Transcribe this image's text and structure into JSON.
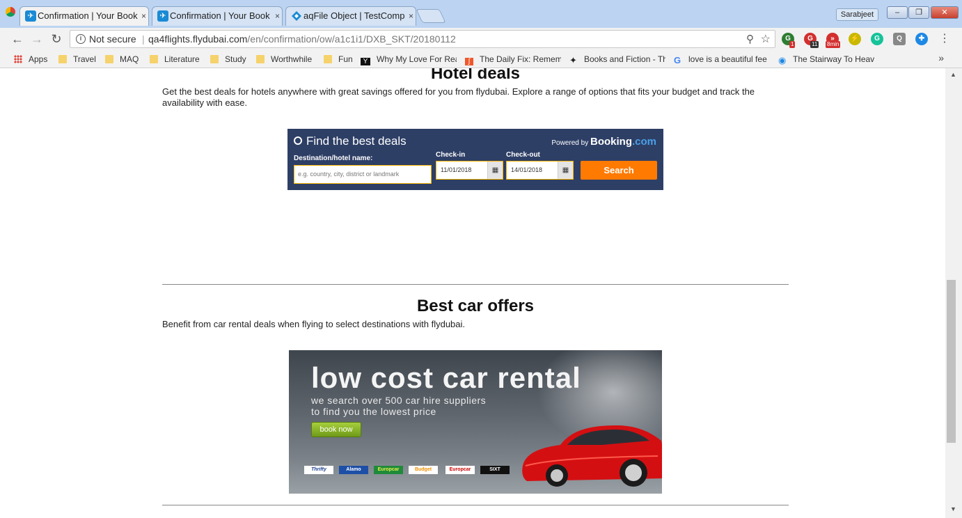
{
  "browser": {
    "tabs": [
      {
        "title": "Confirmation | Your Book",
        "state": "active"
      },
      {
        "title": "Confirmation | Your Book",
        "state": "inactive"
      },
      {
        "title": "aqFile Object | TestComp",
        "state": "inactive"
      }
    ],
    "close_glyph": "×",
    "user_name": "Sarabjeet",
    "window_buttons": {
      "minimize": "–",
      "restore": "❐",
      "close": "✕"
    },
    "nav": {
      "back": "←",
      "forward": "→",
      "reload": "↻"
    },
    "address_bar": {
      "security_label": "Not secure",
      "url_host": "qa4flights.flydubai.com",
      "url_path": "/en/confirmation/ow/a1c1i1/DXB_SKT/20180112"
    },
    "extensions": [
      {
        "name": "extension-1-icon",
        "glyph": "G",
        "color": "#2e7d32",
        "badge": "1"
      },
      {
        "name": "extension-2-icon",
        "glyph": "G",
        "color": "#d32f2f",
        "badge": "11"
      },
      {
        "name": "extension-3-icon",
        "glyph": "»",
        "color": "#d32f2f",
        "badge": "8min"
      },
      {
        "name": "extension-4-icon",
        "glyph": "⚡",
        "color": "#c9b800",
        "badge": ""
      },
      {
        "name": "grammarly-icon",
        "glyph": "G",
        "color": "#15c39a",
        "badge": ""
      },
      {
        "name": "extension-6-icon",
        "glyph": "Q",
        "color": "#888888",
        "badge": ""
      },
      {
        "name": "extension-7-icon",
        "glyph": "✚",
        "color": "#1e88e5",
        "badge": ""
      }
    ],
    "menu_glyph": "⋮",
    "bookmarks": [
      {
        "label": "Apps",
        "icon": "apps"
      },
      {
        "label": "Travel",
        "icon": "folder"
      },
      {
        "label": "MAQ",
        "icon": "folder"
      },
      {
        "label": "Literature",
        "icon": "folder"
      },
      {
        "label": "Study",
        "icon": "folder"
      },
      {
        "label": "Worthwhile",
        "icon": "folder"
      },
      {
        "label": "Fun",
        "icon": "folder"
      },
      {
        "label": "Why My Love For Rea",
        "icon": "y"
      },
      {
        "label": "The Daily Fix: Remem",
        "icon": "scroll"
      },
      {
        "label": "Books and Fiction - Th",
        "icon": "pin"
      },
      {
        "label": "love is a beautiful fee",
        "icon": "google"
      },
      {
        "label": "The Stairway To Heav",
        "icon": "location"
      }
    ],
    "bookmarks_overflow": "»"
  },
  "page": {
    "hotel": {
      "title": "Hotel deals",
      "description": "Get the best deals for hotels anywhere with great savings offered for you from flydubai. Explore a range of options that fits your budget and track the availability with ease."
    },
    "booking_widget": {
      "heading": "Find the best deals",
      "powered_by": "Powered by",
      "brand_name": "Booking",
      "brand_suffix": ".com",
      "destination_label": "Destination/hotel name:",
      "destination_placeholder": "e.g. country, city, district or landmark",
      "checkin_label": "Check-in",
      "checkin_value": "11/01/2018",
      "checkout_label": "Check-out",
      "checkout_value": "14/01/2018",
      "search_label": "Search",
      "calendar_glyph": "▦"
    },
    "car": {
      "title": "Best car offers",
      "description": "Benefit from car rental deals when flying to select destinations with flydubai."
    },
    "car_banner": {
      "headline": "low cost car rental",
      "sub_line1": "we search over 500 car hire suppliers",
      "sub_line2": "to find you the lowest price",
      "button": "book now",
      "partner_logos": [
        "Thrifty",
        "Alamo",
        "Europcar",
        "Budget",
        "Europcar",
        "SIXT"
      ]
    },
    "scrollbar": {
      "up": "▲",
      "down": "▼"
    }
  }
}
